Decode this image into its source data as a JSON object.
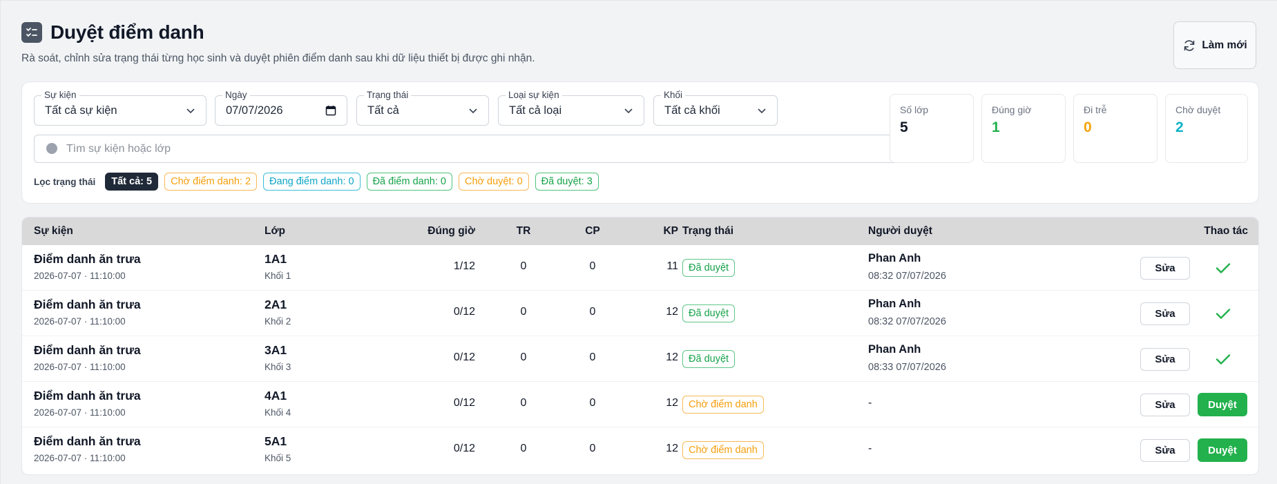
{
  "header": {
    "title": "Duyệt điểm danh",
    "subtitle": "Rà soát, chỉnh sửa trạng thái từng học sinh và duyệt phiên điểm danh sau khi dữ liệu thiết bị được ghi nhận.",
    "refresh_label": "Làm mới"
  },
  "filters": {
    "event": {
      "label": "Sự kiện",
      "value": "Tất cả sự kiện"
    },
    "date": {
      "label": "Ngày",
      "value": "07/07/2026"
    },
    "status": {
      "label": "Trạng thái",
      "value": "Tất cả"
    },
    "event_type": {
      "label": "Loại sự kiện",
      "value": "Tất cả loại"
    },
    "grade": {
      "label": "Khối",
      "value": "Tất cả khối"
    },
    "search_placeholder": "Tìm sự kiện hoặc lớp",
    "status_filter_label": "Lọc trạng thái",
    "chips": [
      "Tất cả: 5",
      "Chờ điểm danh: 2",
      "Đang điểm danh: 0",
      "Đã điểm danh: 0",
      "Chờ duyệt: 0",
      "Đã duyệt: 3"
    ]
  },
  "stats": [
    {
      "label": "Số lớp",
      "value": "5",
      "color": "#111827"
    },
    {
      "label": "Đúng giờ",
      "value": "1",
      "color": "#22b14c"
    },
    {
      "label": "Đi trễ",
      "value": "0",
      "color": "#f5a30b"
    },
    {
      "label": "Chờ duyệt",
      "value": "2",
      "color": "#0fb3c9"
    }
  ],
  "table": {
    "headers": {
      "event": "Sự kiện",
      "class": "Lớp",
      "on_time": "Đúng giờ",
      "tr": "TR",
      "cp": "CP",
      "kp": "KP",
      "status": "Trạng thái",
      "approver": "Người duyệt",
      "actions": "Thao tác"
    },
    "edit_label": "Sửa",
    "approve_label": "Duyệt",
    "rows": [
      {
        "event": "Điểm danh ăn trưa",
        "time": "2026-07-07 · 11:10:00",
        "class": "1A1",
        "grade": "Khối 1",
        "on_time": "1/12",
        "tr": "0",
        "cp": "0",
        "kp": "11",
        "status": "Đã duyệt",
        "approver": "Phan Anh",
        "approved_at": "08:32 07/07/2026"
      },
      {
        "event": "Điểm danh ăn trưa",
        "time": "2026-07-07 · 11:10:00",
        "class": "2A1",
        "grade": "Khối 2",
        "on_time": "0/12",
        "tr": "0",
        "cp": "0",
        "kp": "12",
        "status": "Đã duyệt",
        "approver": "Phan Anh",
        "approved_at": "08:32 07/07/2026"
      },
      {
        "event": "Điểm danh ăn trưa",
        "time": "2026-07-07 · 11:10:00",
        "class": "3A1",
        "grade": "Khối 3",
        "on_time": "0/12",
        "tr": "0",
        "cp": "0",
        "kp": "12",
        "status": "Đã duyệt",
        "approver": "Phan Anh",
        "approved_at": "08:33 07/07/2026"
      },
      {
        "event": "Điểm danh ăn trưa",
        "time": "2026-07-07 · 11:10:00",
        "class": "4A1",
        "grade": "Khối 4",
        "on_time": "0/12",
        "tr": "0",
        "cp": "0",
        "kp": "12",
        "status": "Chờ điểm danh",
        "approver": "-"
      },
      {
        "event": "Điểm danh ăn trưa",
        "time": "2026-07-07 · 11:10:00",
        "class": "5A1",
        "grade": "Khối 5",
        "on_time": "0/12",
        "tr": "0",
        "cp": "0",
        "kp": "12",
        "status": "Chờ điểm danh",
        "approver": "-"
      }
    ]
  }
}
